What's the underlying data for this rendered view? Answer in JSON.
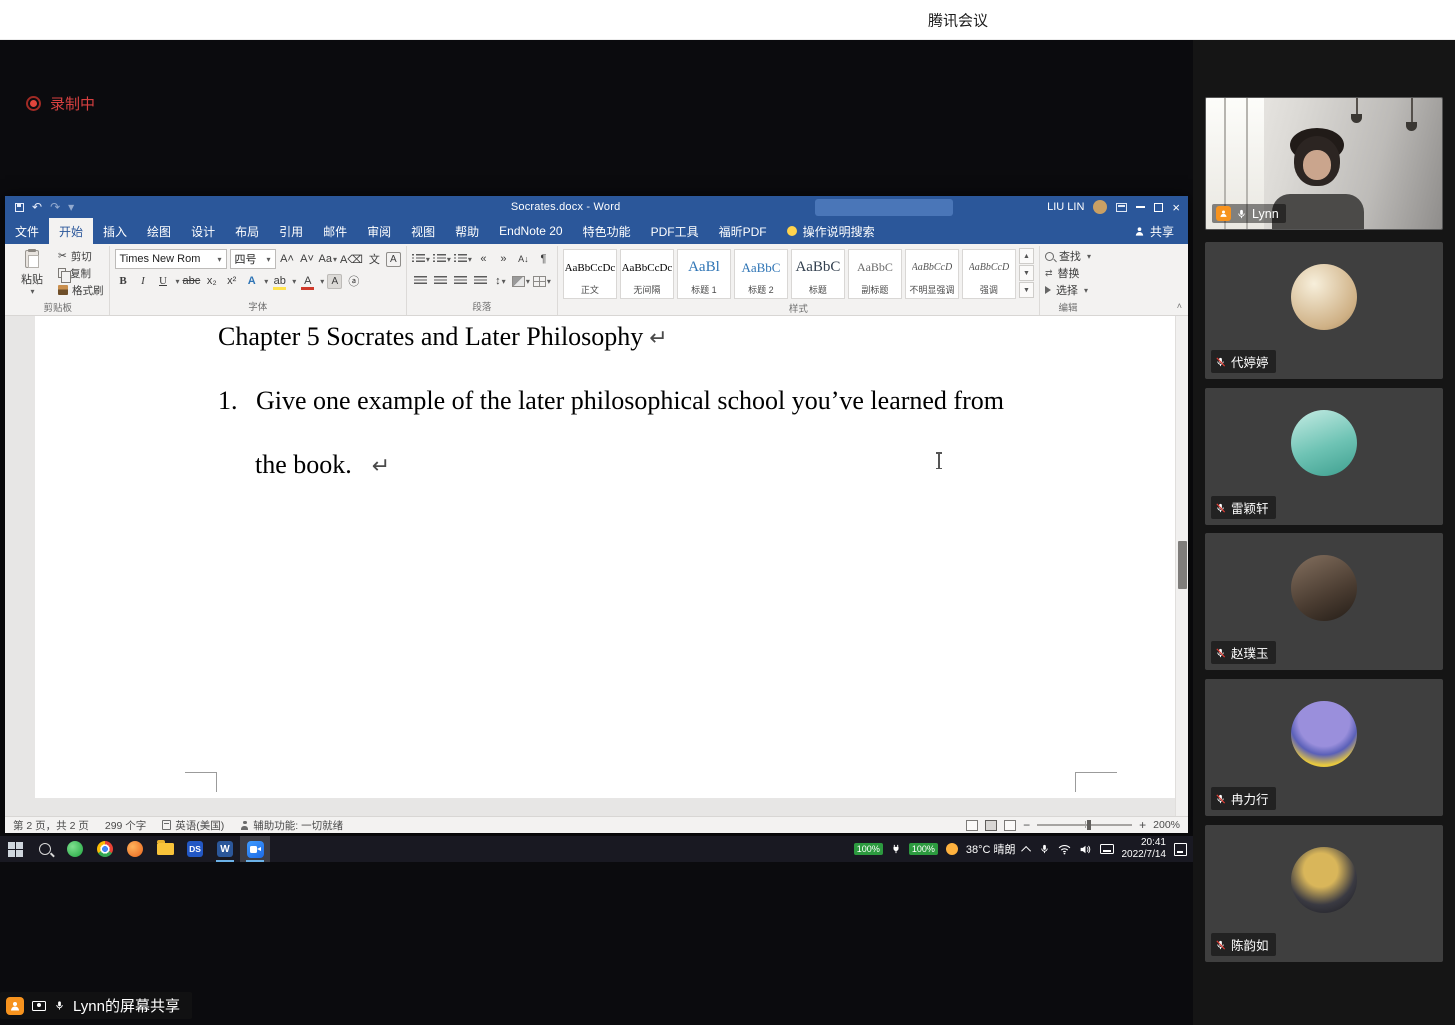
{
  "meeting": {
    "app_title": "腾讯会议",
    "recording_label": "录制中",
    "screen_share_label": "Lynn的屏幕共享",
    "participants": [
      {
        "name": "Lynn"
      },
      {
        "name": "代婷婷"
      },
      {
        "name": "雷颖轩"
      },
      {
        "name": "赵璞玉"
      },
      {
        "name": "冉力行"
      },
      {
        "name": "陈韵如"
      }
    ]
  },
  "word": {
    "window_title": "Socrates.docx  -  Word",
    "account_name": "LIU LIN",
    "tabs": [
      "文件",
      "开始",
      "插入",
      "绘图",
      "设计",
      "布局",
      "引用",
      "邮件",
      "审阅",
      "视图",
      "帮助",
      "EndNote 20",
      "特色功能",
      "PDF工具",
      "福昕PDF"
    ],
    "tell_me": "操作说明搜索",
    "share_button": "共享",
    "clipboard": {
      "group_label": "剪贴板",
      "paste": "粘贴",
      "cut": "剪切",
      "copy": "复制",
      "format_painter": "格式刷"
    },
    "font": {
      "group_label": "字体",
      "family": "Times New Rom",
      "size": "四号"
    },
    "paragraph": {
      "group_label": "段落"
    },
    "styles": {
      "group_label": "样式",
      "items": [
        {
          "preview": "AaBbCcDc",
          "label": "正文"
        },
        {
          "preview": "AaBbCcDc",
          "label": "无间隔"
        },
        {
          "preview": "AaBl",
          "label": "标题 1"
        },
        {
          "preview": "AaBbC",
          "label": "标题 2"
        },
        {
          "preview": "AaBbC",
          "label": "标题"
        },
        {
          "preview": "AaBbC",
          "label": "副标题"
        },
        {
          "preview": "AaBbCcD",
          "label": "不明显强调"
        },
        {
          "preview": "AaBbCcD",
          "label": "强调"
        }
      ]
    },
    "editing": {
      "group_label": "编辑",
      "find": "查找",
      "replace": "替换",
      "select": "选择"
    },
    "document": {
      "heading": "Chapter 5 Socrates and Later Philosophy",
      "list_number": "1.",
      "line1": "Give one example of the later philosophical school you’ve learned from",
      "line2": "the book.",
      "return_mark": "↵"
    },
    "status": {
      "page_info": "第 2 页，共 2 页",
      "word_count": "299 个字",
      "language": "英语(美国)",
      "accessibility": "辅助功能: 一切就绪",
      "zoom_level": "200%",
      "zoom_minus": "−",
      "zoom_plus": "+"
    }
  },
  "taskbar": {
    "ds_label": "DS",
    "word_label": "W",
    "battery_badge_1": "100%",
    "battery_badge_2": "100%",
    "weather": "38°C 晴朗",
    "clock_time": "20:41",
    "clock_date": "2022/7/14"
  }
}
